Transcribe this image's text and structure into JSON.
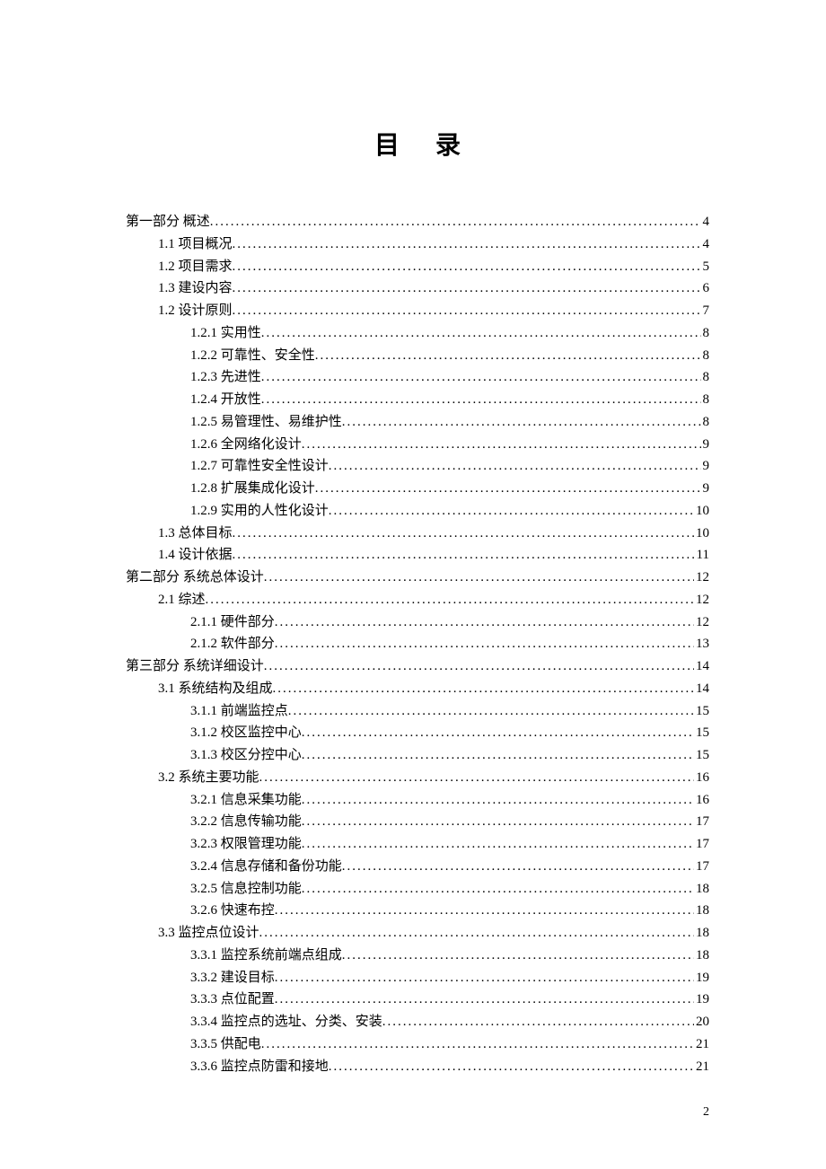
{
  "title": "目录",
  "page_number": "2",
  "toc": [
    {
      "level": 0,
      "label": "第一部分 概述",
      "page": "4"
    },
    {
      "level": 1,
      "label": "1.1 项目概况",
      "page": "4"
    },
    {
      "level": 1,
      "label": "1.2 项目需求",
      "page": "5"
    },
    {
      "level": 1,
      "label": "1.3 建设内容",
      "page": "6"
    },
    {
      "level": 1,
      "label": "1.2 设计原则",
      "page": "7"
    },
    {
      "level": 2,
      "label": "1.2.1 实用性",
      "page": "8"
    },
    {
      "level": 2,
      "label": "1.2.2 可靠性、安全性",
      "page": "8"
    },
    {
      "level": 2,
      "label": "1.2.3 先进性",
      "page": "8"
    },
    {
      "level": 2,
      "label": "1.2.4 开放性",
      "page": "8"
    },
    {
      "level": 2,
      "label": "1.2.5 易管理性、易维护性",
      "page": "8"
    },
    {
      "level": 2,
      "label": "1.2.6 全网络化设计",
      "page": "9"
    },
    {
      "level": 2,
      "label": "1.2.7 可靠性安全性设计",
      "page": "9"
    },
    {
      "level": 2,
      "label": "1.2.8 扩展集成化设计",
      "page": "9"
    },
    {
      "level": 2,
      "label": "1.2.9 实用的人性化设计",
      "page": "10"
    },
    {
      "level": 1,
      "label": "1.3 总体目标",
      "page": "10"
    },
    {
      "level": 1,
      "label": "1.4 设计依据",
      "page": "11"
    },
    {
      "level": 0,
      "label": "第二部分 系统总体设计",
      "page": "12"
    },
    {
      "level": 1,
      "label": "2.1 综述",
      "page": "12"
    },
    {
      "level": 2,
      "label": "2.1.1 硬件部分",
      "page": "12"
    },
    {
      "level": 2,
      "label": "2.1.2 软件部分",
      "page": "13"
    },
    {
      "level": 0,
      "label": "第三部分 系统详细设计",
      "page": "14"
    },
    {
      "level": 1,
      "label": "3.1 系统结构及组成",
      "page": "14"
    },
    {
      "level": 2,
      "label": "3.1.1 前端监控点",
      "page": "15"
    },
    {
      "level": 2,
      "label": "3.1.2 校区监控中心",
      "page": "15"
    },
    {
      "level": 2,
      "label": "3.1.3 校区分控中心",
      "page": "15"
    },
    {
      "level": 1,
      "label": "3.2 系统主要功能",
      "page": "16"
    },
    {
      "level": 2,
      "label": "3.2.1 信息采集功能",
      "page": "16"
    },
    {
      "level": 2,
      "label": "3.2.2 信息传输功能",
      "page": "17"
    },
    {
      "level": 2,
      "label": "3.2.3 权限管理功能",
      "page": "17"
    },
    {
      "level": 2,
      "label": "3.2.4 信息存储和备份功能",
      "page": "17"
    },
    {
      "level": 2,
      "label": "3.2.5 信息控制功能",
      "page": "18"
    },
    {
      "level": 2,
      "label": "3.2.6 快速布控",
      "page": "18"
    },
    {
      "level": 1,
      "label": "3.3 监控点位设计",
      "page": "18"
    },
    {
      "level": 2,
      "label": "3.3.1 监控系统前端点组成",
      "page": "18"
    },
    {
      "level": 2,
      "label": "3.3.2 建设目标",
      "page": "19"
    },
    {
      "level": 2,
      "label": "3.3.3 点位配置",
      "page": "19"
    },
    {
      "level": 2,
      "label": "3.3.4 监控点的选址、分类、安装",
      "page": "20"
    },
    {
      "level": 2,
      "label": "3.3.5 供配电",
      "page": "21"
    },
    {
      "level": 2,
      "label": "3.3.6 监控点防雷和接地",
      "page": "21"
    }
  ]
}
